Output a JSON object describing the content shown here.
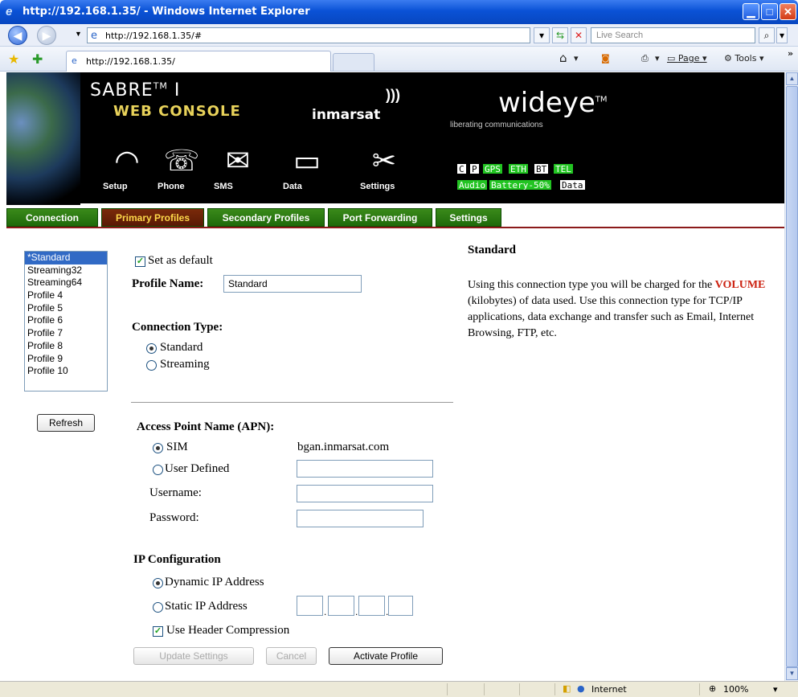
{
  "window": {
    "title": "http://192.168.1.35/ - Windows Internet Explorer"
  },
  "browser": {
    "address": "http://192.168.1.35/#",
    "search_placeholder": "Live Search",
    "tab_title": "http://192.168.1.35/",
    "page_menu": "Page",
    "tools_menu": "Tools",
    "status_zone": "Internet",
    "zoom": "100%"
  },
  "banner": {
    "product": "SABRE",
    "tm": "TM",
    "product_suffix": "I",
    "console": "WEB CONSOLE",
    "inmarsat": "inmarsat",
    "wideye": "wideye",
    "wideye_tm": "TM",
    "tagline": "liberating communications",
    "nav": [
      {
        "label": "Setup",
        "icon": "setup-icon"
      },
      {
        "label": "Phone",
        "icon": "phone-icon"
      },
      {
        "label": "SMS",
        "icon": "sms-icon"
      },
      {
        "label": "Data",
        "icon": "data-icon"
      },
      {
        "label": "Settings",
        "icon": "settings-icon"
      }
    ],
    "indicators_row1": [
      "C",
      "P",
      "GPS",
      "ETH",
      "BT",
      "TEL"
    ],
    "indicators_row2": [
      "Audio",
      "Battery-50%",
      "Data"
    ]
  },
  "tabs": [
    "Connection",
    "Primary Profiles",
    "Secondary Profiles",
    "Port Forwarding",
    "Settings"
  ],
  "profiles": {
    "items": [
      "*Standard",
      "Streaming32",
      "Streaming64",
      "Profile 4",
      "Profile 5",
      "Profile 6",
      "Profile 7",
      "Profile 8",
      "Profile 9",
      "Profile 10"
    ],
    "refresh": "Refresh"
  },
  "form": {
    "set_default": "Set as default",
    "profile_name_label": "Profile Name:",
    "profile_name_value": "Standard",
    "connection_type_label": "Connection Type:",
    "ct_standard": "Standard",
    "ct_streaming": "Streaming",
    "apn_label": "Access Point Name (APN):",
    "apn_sim": "SIM",
    "apn_sim_value": "bgan.inmarsat.com",
    "apn_user": "User Defined",
    "username": "Username:",
    "password": "Password:",
    "ip_config": "IP Configuration",
    "ip_dynamic": "Dynamic IP Address",
    "ip_static": "Static IP Address",
    "header_comp": "Use Header Compression",
    "update": "Update Settings",
    "cancel": "Cancel",
    "activate": "Activate Profile"
  },
  "info": {
    "title": "Standard",
    "p1": "Using this connection type you will be charged for the",
    "volume": "VOLUME",
    "p2": " (kilobytes) of data used. Use this connection type for TCP/IP applications, data exchange and transfer such as Email, Internet Browsing, FTP, etc."
  }
}
